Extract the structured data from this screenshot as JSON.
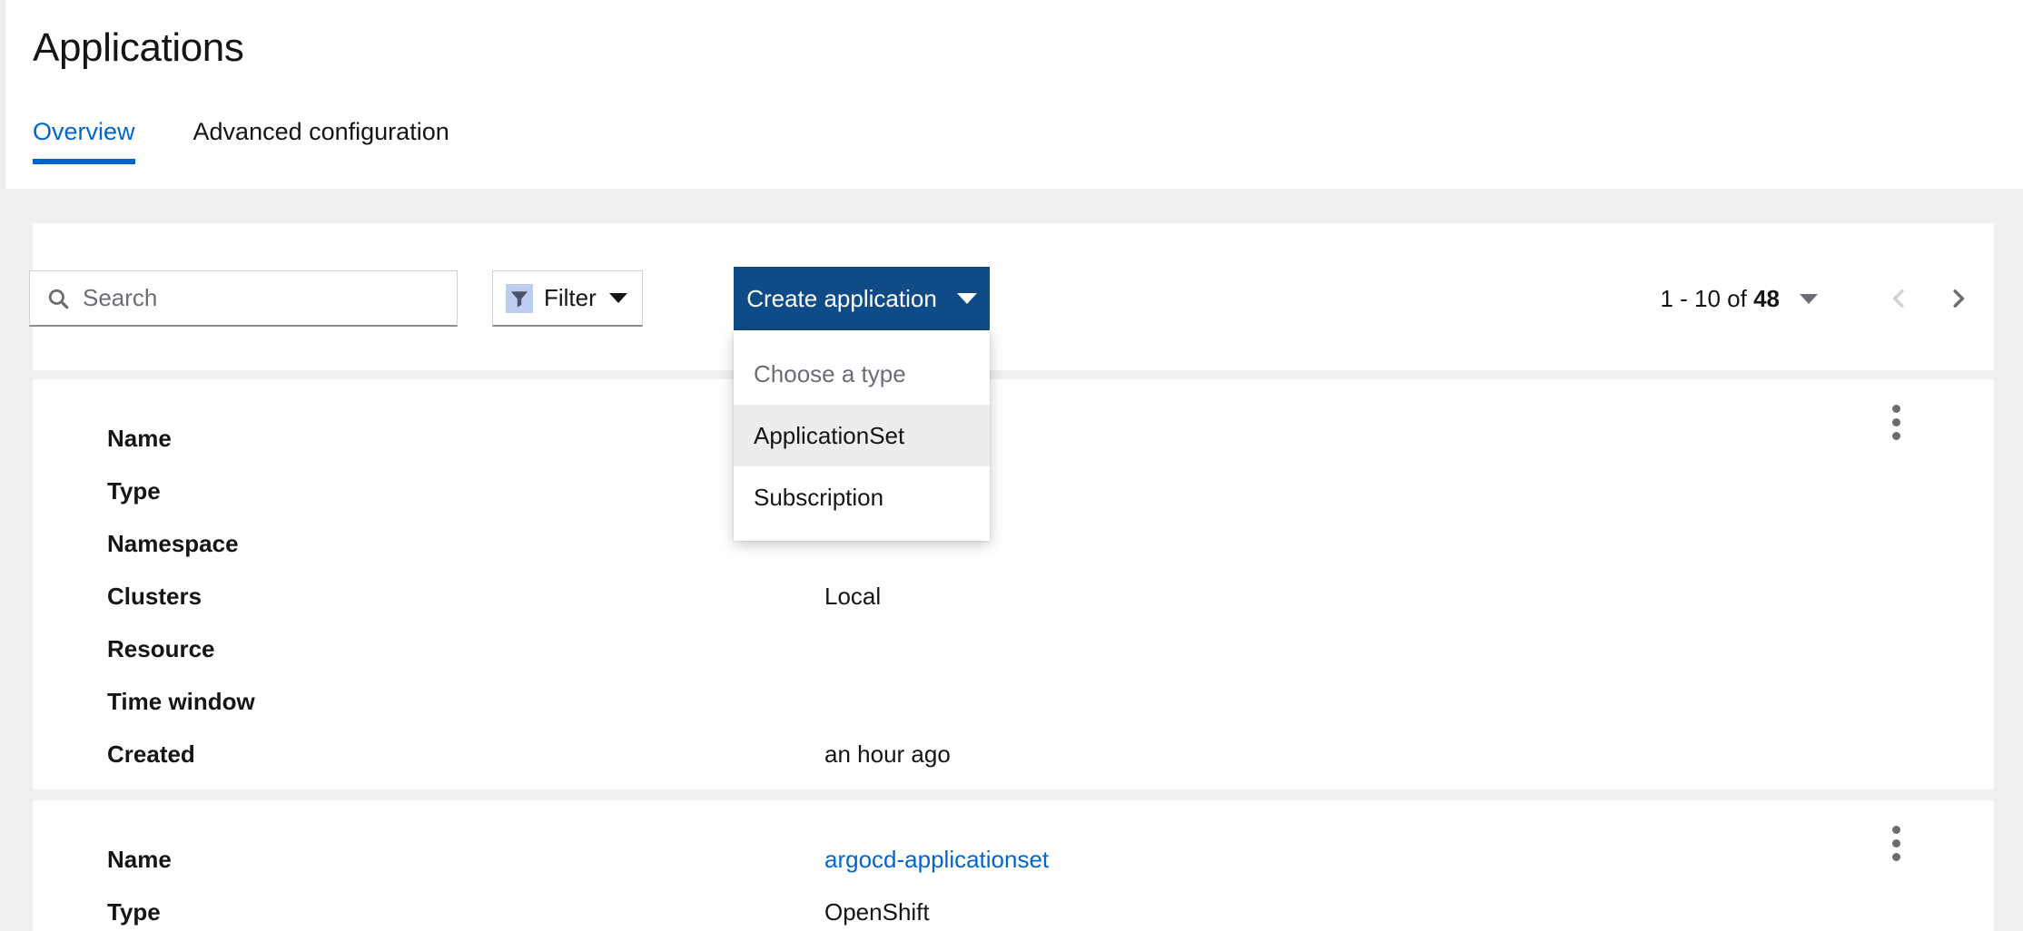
{
  "header": {
    "title": "Applications",
    "tabs": [
      {
        "label": "Overview",
        "active": true
      },
      {
        "label": "Advanced configuration",
        "active": false
      }
    ]
  },
  "toolbar": {
    "search": {
      "placeholder": "Search",
      "value": "",
      "icon": "search-icon"
    },
    "filter": {
      "label": "Filter",
      "icon": "filter-icon",
      "caret": "chevron-down-icon"
    },
    "create_button": {
      "label": "Create application",
      "caret": "chevron-down-icon"
    },
    "create_menu": {
      "header": "Choose a type",
      "items": [
        {
          "label": "ApplicationSet",
          "highlighted": true
        },
        {
          "label": "Subscription",
          "highlighted": false
        }
      ]
    },
    "pagination": {
      "range_prefix": "1 - 10 of ",
      "total": "48",
      "summary": "1 - 10 of 48",
      "per_page_caret": "chevron-down-icon",
      "prev_icon": "chevron-left-icon",
      "next_icon": "chevron-right-icon",
      "prev_disabled": true,
      "next_disabled": false
    }
  },
  "rows": [
    {
      "kebab": "more-vertical-icon",
      "fields": [
        {
          "label": "Name",
          "value": "",
          "link": false
        },
        {
          "label": "Type",
          "value": "",
          "link": false
        },
        {
          "label": "Namespace",
          "value": "",
          "link": false
        },
        {
          "label": "Clusters",
          "value": "Local",
          "link": false
        },
        {
          "label": "Resource",
          "value": "",
          "link": false
        },
        {
          "label": "Time window",
          "value": "",
          "link": false
        },
        {
          "label": "Created",
          "value": "an hour ago",
          "link": false
        }
      ]
    },
    {
      "kebab": "more-vertical-icon",
      "fields": [
        {
          "label": "Name",
          "value": "argocd-applicationset",
          "link": true
        },
        {
          "label": "Type",
          "value": "OpenShift",
          "link": false
        }
      ]
    }
  ],
  "colors": {
    "accent_blue": "#06c",
    "primary_button": "#0f4c87",
    "link": "#06c",
    "page_background": "#f0f0f0",
    "card_background": "#ffffff",
    "menu_highlight": "#ededed",
    "muted_text": "#6a6e73",
    "filter_icon_bg": "#bdcdf0"
  }
}
